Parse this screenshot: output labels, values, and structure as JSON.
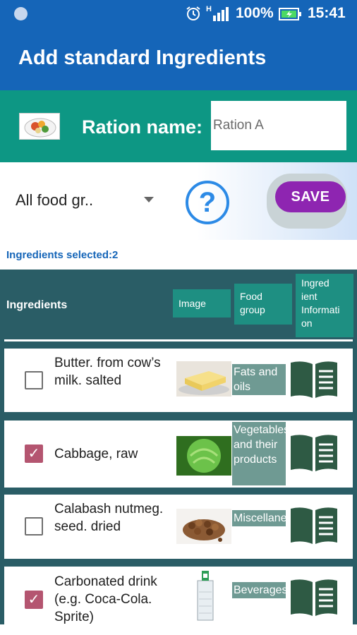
{
  "status_bar": {
    "network_label": "H",
    "battery_percent": "100%",
    "time": "15:41",
    "icons": [
      "notification-dot-icon",
      "alarm-icon",
      "signal-icon",
      "battery-charging-icon"
    ]
  },
  "app_bar": {
    "title": "Add standard Ingredients"
  },
  "ration": {
    "label": "Ration name:",
    "value": "Ration A"
  },
  "controls": {
    "food_group_selected": "All food gr..",
    "help_symbol": "?",
    "save_label": "SAVE"
  },
  "selected_count_text": "Ingredients selected:2",
  "table": {
    "headers": {
      "ingredients": "Ingredients",
      "image": "Image",
      "food_group": "Food group",
      "information": "Ingred ient Informati on"
    },
    "rows": [
      {
        "name": "Butter. from cow’s milk. salted",
        "food_group": "Fats and oils",
        "checked": false,
        "image_icon": "butter-image"
      },
      {
        "name": "Cabbage, raw",
        "food_group": "Vegetables and their products",
        "checked": true,
        "image_icon": "cabbage-image"
      },
      {
        "name": "Calabash nutmeg. seed. dried",
        "food_group": "Miscellaneous",
        "checked": false,
        "image_icon": "nutmeg-seeds-image"
      },
      {
        "name": "Carbonated drink (e.g. Coca-Cola. Sprite)",
        "food_group": "Beverages",
        "checked": true,
        "image_icon": "soda-glass-image"
      }
    ]
  },
  "colors": {
    "app_bar": "#1565b8",
    "ration_bar": "#0d9784",
    "table_bg": "#2a5d66",
    "header_cell": "#1e8f82",
    "group_cell": "#6f9a93",
    "save_button": "#8e25b1",
    "checkbox_checked": "#b45570"
  }
}
